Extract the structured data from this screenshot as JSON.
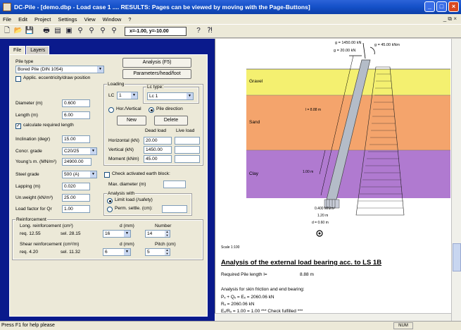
{
  "window": {
    "title": "DC-Pile - [demo.dbp - Load case 1 .... RESULTS: Pages can be viewed by moving with the Page-Buttons]",
    "buttons": {
      "minimize": "_",
      "maximize": "□",
      "close": "×"
    }
  },
  "menu": [
    "File",
    "Edit",
    "Project",
    "Settings",
    "View",
    "Window",
    "?"
  ],
  "menu_mdi": "_ ⧉ ×",
  "toolbar": {
    "coord_readout": "x=-1.00, y=-10.00",
    "icons": [
      "new-file-icon",
      "open-folder-icon",
      "save-icon",
      "print-icon",
      "print-preview-icon",
      "export-icon",
      "zoom-in-icon",
      "zoom-out-icon",
      "zoom-window-icon",
      "zoom-all-icon",
      "help-icon",
      "context-help-icon"
    ]
  },
  "tabs": [
    "File",
    "Layers"
  ],
  "form": {
    "pile_type_label": "Pile type",
    "pile_type_value": "Bored Pile (DIN 1054)",
    "applic_eccentricity": "Applic. eccentricity/draw position",
    "analysis_button": "Analysis (F5)",
    "params_button": "Parameters/head/foot",
    "loading_group": "Loading",
    "lc_label": "LC",
    "lc_value": "1",
    "lc_type_group": "Lc type:",
    "lc_type_value": "Lc 1",
    "hor_vertical": "Hor./Vertical",
    "pile_direction": "Pile direction",
    "new_button": "New",
    "delete_button": "Delete",
    "dead_load_header": "Dead load",
    "live_load_header": "Live load",
    "horizontal_label": "Horizontal (kN)",
    "horizontal_value": "20.00",
    "vertical_label": "Vertical (kN)",
    "vertical_value": "1450.00",
    "moment_label": "Moment (kNm)",
    "moment_value": "45.00",
    "diameter_label": "Diameter (m)",
    "diameter_value": "0.600",
    "length_label": "Length (m)",
    "length_value": "6.00",
    "calc_length_label": "calculate required length",
    "inclination_label": "Inclination (degr)",
    "inclination_value": "15.00",
    "concr_grade_label": "Concr. grade",
    "concr_grade_value": "C20/25",
    "youngs_label": "Young's m. (MN/m²)",
    "youngs_value": "24900.00",
    "steel_grade_label": "Steel grade",
    "steel_grade_value": "500 (A)",
    "check_earth_block": "Check activated earth block:",
    "max_diameter_label": "Max. diameter (m)",
    "lapping_label": "Lapping (m)",
    "lapping_value": "0.020",
    "unit_weight_label": "Un.weight (kN/m³)",
    "unit_weight_value": "25.00",
    "load_factor_label": "Load factor for Qr",
    "load_factor_value": "1.00",
    "analysis_with_group": "Analysis with",
    "limit_load": "Limit load (/safety)",
    "perm_settle": "Perm. settle. (cm):",
    "reinforcement_group": "Reinforcement",
    "long_reinf_label": "Long. reinforcement (cm²)",
    "d_mm_label": "d (mm)",
    "number_label": "Number",
    "long_req": "req.   12.55",
    "long_sel": "sel.   28.15",
    "long_d": "16",
    "long_number": "14",
    "shear_reinf_label": "Shear reinforcement (cm²/m)",
    "d_mm_label2": "d (mm)",
    "pitch_label": "Pitch (cm)",
    "shear_req": "req.    4.20",
    "shear_sel": "sel.   11.32",
    "shear_d": "6",
    "shear_pitch": "5"
  },
  "drawing": {
    "layers": [
      {
        "name": "Gravel",
        "color": "#f4f070"
      },
      {
        "name": "Sand",
        "color": "#f4a46c"
      },
      {
        "name": "Clay",
        "color": "#b07ad0"
      }
    ],
    "load_labels": [
      "g = 1450.00 kN",
      "g = 20.00 kN",
      "g = 45.00 kNm"
    ],
    "dim_length": "l = 8.88 m",
    "dim_clay": "1.00 m",
    "foot_labels": [
      "0.400 MN/m²",
      "1.20 m",
      "d = 0.60 m"
    ],
    "scale": "Scale 1:100"
  },
  "results": {
    "heading": "Analysis of the external load bearing acc. to LS 1B",
    "req_length_label": "Required Pile length  l=",
    "req_length_value": "8.88 m",
    "skin_label": "Analysis for skin friction and end bearing:",
    "line1": "Pₓ + Qₓ = Eₓ          =        2060.06 kN",
    "line2": "Rₓ                           =        2060.06 kN",
    "line3": "Eₓ/Rₓ = 1.00 = 1.00   *** Check fulfilled ***"
  },
  "status": {
    "help": "Press F1 for help please",
    "num": "NUM"
  }
}
